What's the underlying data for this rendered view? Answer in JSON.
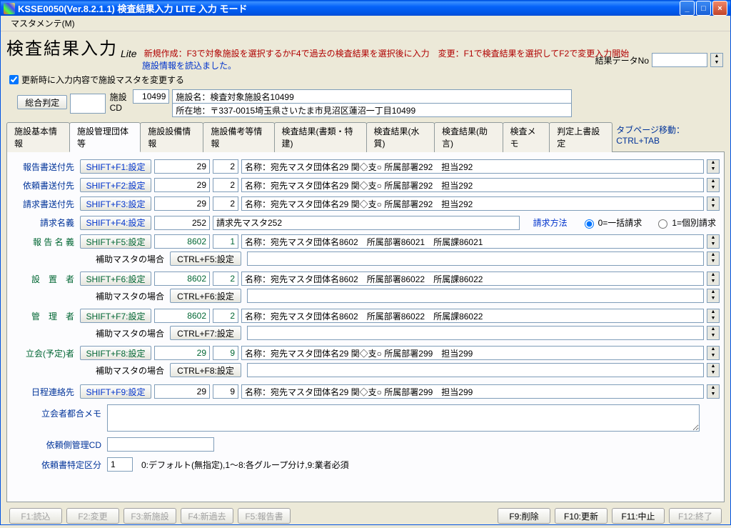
{
  "window": {
    "title": "KSSE0050(Ver.8.2.1.1) 検査結果入力 LITE 入力 モード"
  },
  "menu": {
    "item1": "マスタメンテ(M)",
    "item1_underline": "M"
  },
  "header": {
    "main_title": "検査結果入力",
    "lite": "Lite",
    "help1": "新規作成：F3で対象施設を選択するかF4で過去の検査結果を選択後に入力　変更：F1で検査結果を選択してF2で変更入力開始",
    "help2": "施設情報を読込ました。",
    "checkbox_label": "更新時に入力内容で施設マスタを変更する",
    "result_label": "結果データNo",
    "shisetsu_cd_label": "施設CD",
    "shisetsu_cd": "10499",
    "shisetsu_name": "施設名：検査対象施設名10499",
    "shisetsu_addr": "所在地：〒337-0015埼玉県さいたま市見沼区蓮沼一丁目10499",
    "sogo_label": "総合判定"
  },
  "tabs": {
    "t1": "施設基本情報",
    "t2": "施設管理団体等",
    "t3": "施設設備情報",
    "t4": "施設備考等情報",
    "t5": "検査結果(書類・特建)",
    "t6": "検査結果(水質)",
    "t7": "検査結果(助言)",
    "t8": "検査メモ",
    "t9": "判定上書設定",
    "hint": "タブページ移動：CTRL+TAB"
  },
  "rows": [
    {
      "label": "報告書送付先",
      "cls": "kblue",
      "labelcls": "lbl-blue",
      "key": "SHIFT+F1:設定",
      "n1": "29",
      "n2": "2",
      "desc": "名称：宛先マスタ団体名29 関◇支○ 所属部署292　担当292"
    },
    {
      "label": "依頼書送付先",
      "cls": "kblue",
      "labelcls": "lbl-blue",
      "key": "SHIFT+F2:設定",
      "n1": "29",
      "n2": "2",
      "desc": "名称：宛先マスタ団体名29 関◇支○ 所属部署292　担当292"
    },
    {
      "label": "請求書送付先",
      "cls": "kblue",
      "labelcls": "lbl-blue",
      "key": "SHIFT+F3:設定",
      "n1": "29",
      "n2": "2",
      "desc": "名称：宛先マスタ団体名29 関◇支○ 所属部署292　担当292"
    }
  ],
  "seikyu": {
    "label": "請求名義",
    "key": "SHIFT+F4:設定",
    "n1": "252",
    "desc": "請求先マスタ252",
    "method_label": "請求方法",
    "opt0": "0=一括請求",
    "opt1": "1=個別請求"
  },
  "rows2": [
    {
      "label": "報 告 名 義",
      "labelcls": "lbl-green",
      "key": "SHIFT+F5:設定",
      "n1": "8602",
      "n2": "1",
      "desc": "名称：宛先マスタ団体名8602　所属部署86021　所属課86021",
      "ctrl": "CTRL+F5:設定",
      "sublabel": "補助マスタの場合"
    },
    {
      "label": "設　置　者",
      "labelcls": "lbl-green",
      "key": "SHIFT+F6:設定",
      "n1": "8602",
      "n2": "2",
      "desc": "名称：宛先マスタ団体名8602　所属部署86022　所属課86022",
      "ctrl": "CTRL+F6:設定",
      "sublabel": "補助マスタの場合"
    },
    {
      "label": "管　理　者",
      "labelcls": "lbl-green",
      "key": "SHIFT+F7:設定",
      "n1": "8602",
      "n2": "2",
      "desc": "名称：宛先マスタ団体名8602　所属部署86022　所属課86022",
      "ctrl": "CTRL+F7:設定",
      "sublabel": "補助マスタの場合"
    },
    {
      "label": "立会(予定)者",
      "labelcls": "lbl-green",
      "key": "SHIFT+F8:設定",
      "n1": "29",
      "n2": "9",
      "desc": "名称：宛先マスタ団体名29 関◇支○ 所属部署299　担当299",
      "ctrl": "CTRL+F8:設定",
      "sublabel": "補助マスタの場合"
    }
  ],
  "nittei": {
    "label": "日程連絡先",
    "labelcls": "lbl-blue",
    "key": "SHIFT+F9:設定",
    "n1": "29",
    "n2": "9",
    "desc": "名称：宛先マスタ団体名29 関◇支○ 所属部署299　担当299"
  },
  "memo_label": "立会者都合メモ",
  "kanri_cd_label": "依頼側管理CD",
  "tokutei": {
    "label": "依頼書特定区分",
    "val": "1",
    "hint": "0:デフォルト(無指定),1～8:各グループ分け,9:業者必須"
  },
  "fkeys": {
    "f1": "F1:読込",
    "f2": "F2:変更",
    "f3": "F3:新施設",
    "f4": "F4:新過去",
    "f5": "F5:報告書",
    "f9": "F9:削除",
    "f10": "F10:更新",
    "f11": "F11:中止",
    "f12": "F12:終了"
  }
}
